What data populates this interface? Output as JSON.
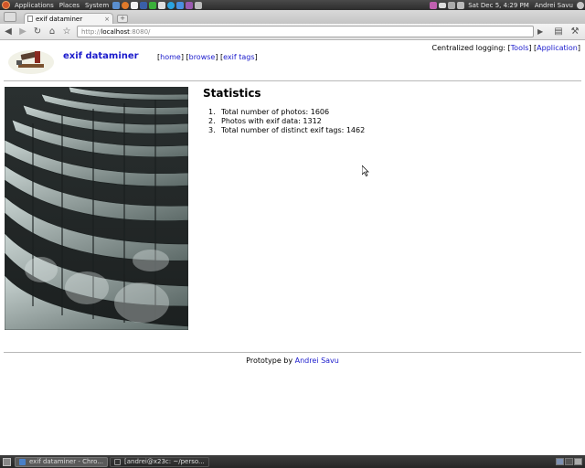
{
  "top_panel": {
    "menus": [
      "Applications",
      "Places",
      "System"
    ],
    "clock": "Sat Dec  5,  4:29 PM",
    "user": "Andrei Savu"
  },
  "browser": {
    "tab_title": "exif dataminer",
    "url_scheme": "http://",
    "url_host": "localhost",
    "url_rest": ":8080/"
  },
  "site": {
    "title": "exif dataminer",
    "nav": [
      "home",
      "browse",
      "exif tags"
    ],
    "logging_prefix": "Centralized logging:",
    "logging_links": [
      "Tools",
      "Application"
    ]
  },
  "stats": {
    "heading": "Statistics",
    "items": [
      "Total number of photos: 1606",
      "Photos with exif data: 1312",
      "Total number of distinct exif tags: 1462"
    ]
  },
  "footer": {
    "prefix": "Prototype by",
    "author": "Andrei Savu"
  },
  "taskbar": {
    "tasks": [
      "exif dataminer - Chro...",
      "[andrei@x23c: ~/perso..."
    ]
  },
  "colors": {
    "link": "#1a1acc",
    "panel": "#2c2c2c"
  }
}
